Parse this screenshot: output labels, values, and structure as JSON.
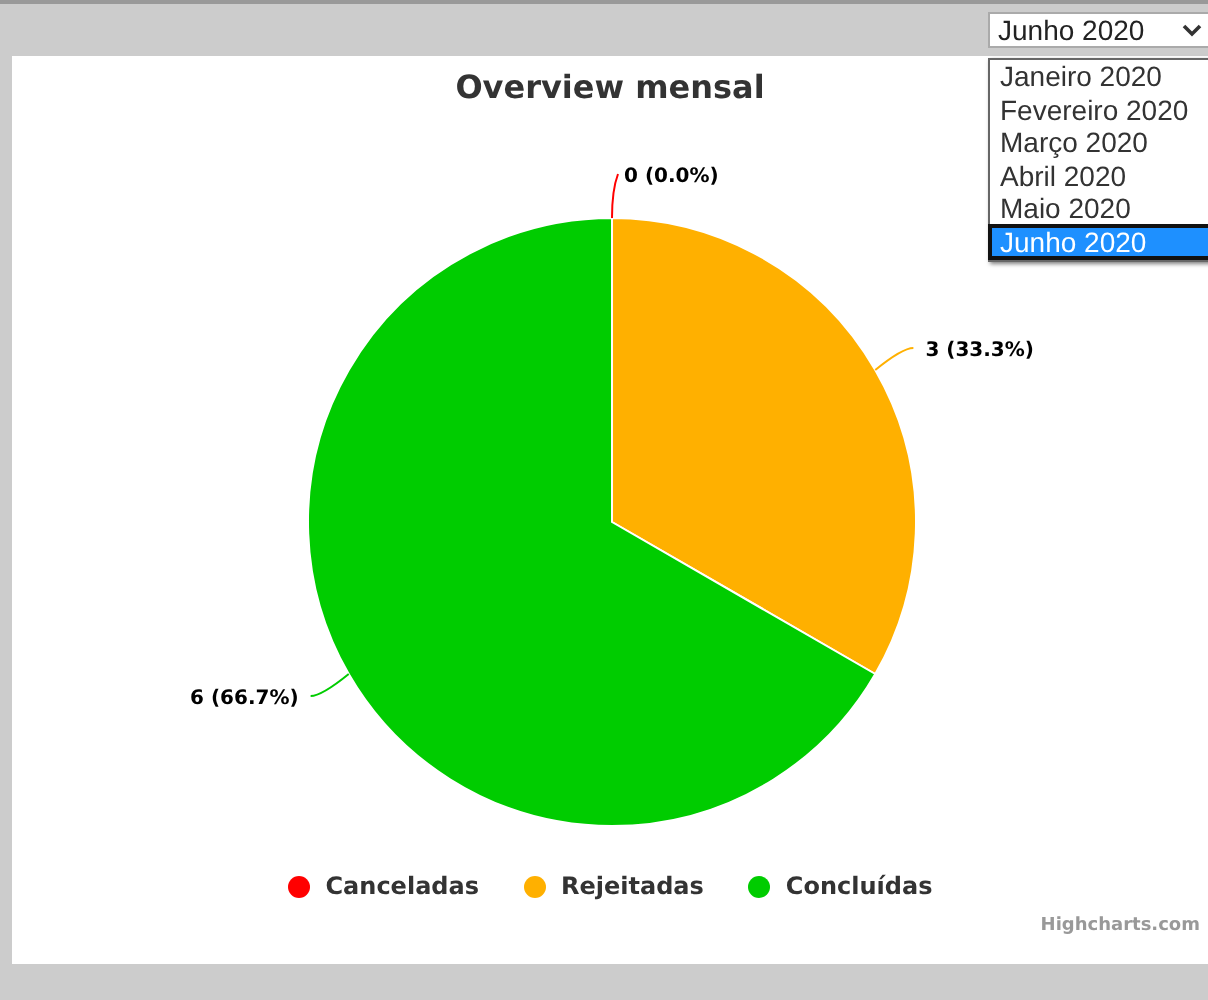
{
  "month_select": {
    "value": "Junho 2020",
    "options": [
      {
        "label": "Janeiro 2020",
        "selected": false
      },
      {
        "label": "Fevereiro 2020",
        "selected": false
      },
      {
        "label": "Março 2020",
        "selected": false
      },
      {
        "label": "Abril 2020",
        "selected": false
      },
      {
        "label": "Maio 2020",
        "selected": false
      },
      {
        "label": "Junho 2020",
        "selected": true
      }
    ]
  },
  "chart": {
    "chart_data": {
      "type": "pie",
      "title": "Overview mensal",
      "categories": [
        "Canceladas",
        "Rejeitadas",
        "Concluídas"
      ],
      "values": [
        0,
        3,
        6
      ],
      "value_labels": [
        "0 (0.0%)",
        "3 (33.3%)",
        "6 (66.7%)"
      ]
    },
    "legend": [
      {
        "color": "#ff0000"
      },
      {
        "color": "#ffb000"
      },
      {
        "color": "#00cc00"
      }
    ],
    "credits": "Highcharts.com"
  }
}
